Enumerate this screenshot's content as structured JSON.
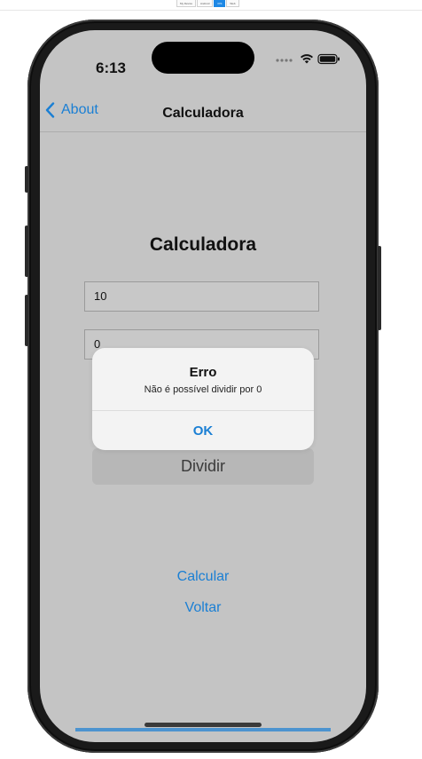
{
  "preview_tabs": [
    "My Device",
    "Android",
    "iOS",
    "Web"
  ],
  "status_bar": {
    "time": "6:13"
  },
  "nav": {
    "back_label": "About",
    "title": "Calculadora"
  },
  "page": {
    "title": "Calculadora",
    "input1_value": "10",
    "input2_value": "0",
    "operation_label": "Dividir",
    "calculate_label": "Calcular",
    "back_label": "Voltar"
  },
  "alert": {
    "title": "Erro",
    "message": "Não é possível dividir por 0",
    "ok_label": "OK"
  },
  "colors": {
    "accent": "#1a7fd4",
    "screen_background": "#c4c4c4",
    "alert_background": "#f3f3f3",
    "frame": "#1a1a1a"
  }
}
